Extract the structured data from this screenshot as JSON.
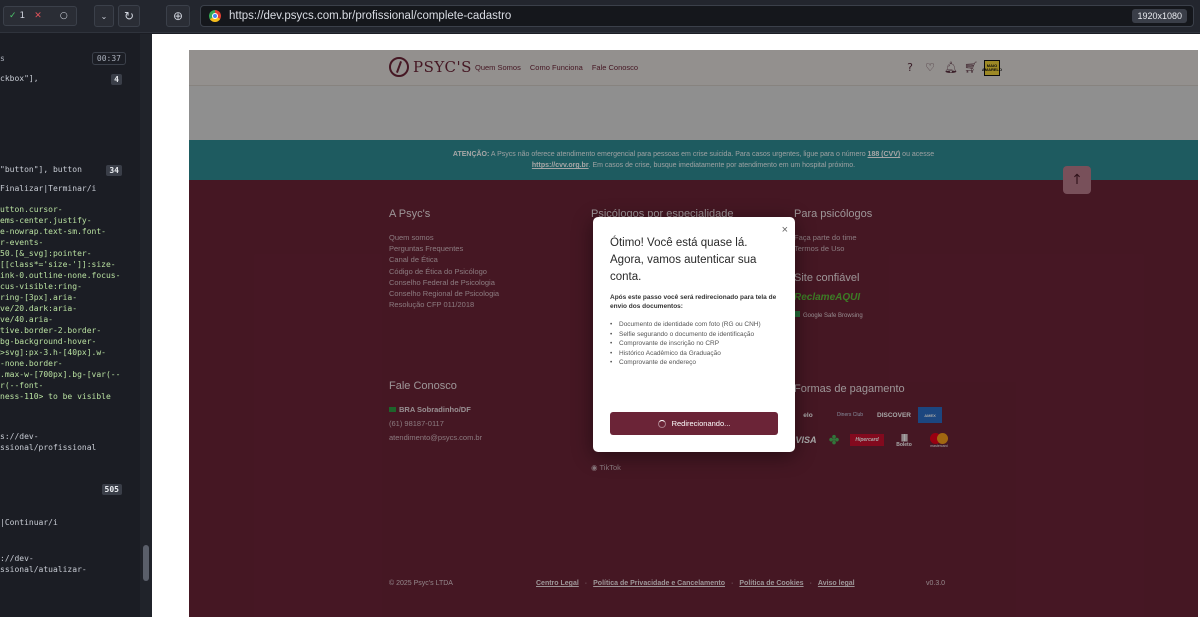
{
  "toolbar": {
    "pass_count": "1",
    "fail_count": "",
    "pending_count": "",
    "url": "https://dev.psycs.com.br/profissional/complete-cadastro",
    "resolution": "1920x1080"
  },
  "left_panel": {
    "header": "s",
    "time": "00:37",
    "lines": [
      {
        "text": "ckbox\"],",
        "badge": "4"
      },
      {
        "text": "\"button\"], button",
        "badge": "34"
      },
      {
        "text": "Finalizar|Terminar/i"
      },
      {
        "text": "utton.cursor-"
      },
      {
        "text": "ems-center.justify-"
      },
      {
        "text": "e-nowrap.text-sm.font-"
      },
      {
        "text": "r-events-"
      },
      {
        "text": "50.[&_svg]:pointer-"
      },
      {
        "text": "[[class*='size-']]:size-"
      },
      {
        "text": "ink-0.outline-none.focus-"
      },
      {
        "text": "cus-visible:ring-"
      },
      {
        "text": "ring-[3px].aria-"
      },
      {
        "text": "ve/20.dark:aria-"
      },
      {
        "text": "ve/40.aria-"
      },
      {
        "text": "tive.border-2.border-"
      },
      {
        "text": "bg-background-hover-"
      },
      {
        "text": ">svg]:px-3.h-[40px].w-"
      },
      {
        "text": "-none.border-"
      },
      {
        "text": ".max-w-[700px].bg-[var(--"
      },
      {
        "text": "r(--font-"
      },
      {
        "text": "ness-110>  to be  visible"
      },
      {
        "text": "s://dev-"
      },
      {
        "text": "ssional/profissional"
      },
      {
        "text": "",
        "badge": "505"
      },
      {
        "text": "|Continuar/i"
      },
      {
        "text": "://dev-"
      },
      {
        "text": "ssional/atualizar-"
      }
    ]
  },
  "site": {
    "logo": "PSYC'S",
    "nav": [
      "Quem Somos",
      "Como Funciona",
      "Fale Conosco"
    ],
    "flag_text": "MAIO AMARELO",
    "attention": {
      "label": "ATENÇÃO:",
      "text1": " A Psycs não oferece atendimento emergencial para pessoas em crise suicida. Para casos urgentes, ligue para o número ",
      "phone": "188 (CVV)",
      "text2": " ou acesse",
      "link": "https://cvv.org.br",
      "text3": ". Em casos de crise, busque imediatamente por atendimento em um hospital próximo."
    },
    "col1": {
      "title": "A Psyc's",
      "links": [
        "Quem somos",
        "Perguntas Frequentes",
        "Canal de Ética",
        "Código de Ética do Psicólogo",
        "Conselho Federal de Psicologia",
        "Conselho Regional de Psicologia",
        "Resolução CFP 011/2018"
      ]
    },
    "col2": {
      "title": "Psicólogos por especialidade",
      "social": "TikTok"
    },
    "col3": {
      "title": "Para psicólogos",
      "links": [
        "Faça parte do time",
        "Termos de Uso"
      ],
      "trust_title": "Site confiável",
      "reclame": "ReclameAQUI",
      "safe": "Google Safe Browsing",
      "pay_title": "Formas de pagamento",
      "pay_row1": [
        "elo",
        "Diners Club",
        "DISCOVER",
        "AMEX"
      ],
      "pay_row2": [
        "VISA",
        "",
        "Hipercard",
        "Boleto",
        "mastercard"
      ]
    },
    "contact": {
      "title": "Fale Conosco",
      "location": "BRA Sobradinho/DF",
      "phone": "(61) 98187-0117",
      "email": "atendimento@psycs.com.br"
    },
    "footer": {
      "copyright": "© 2025 Psyc's LTDA",
      "legal": [
        "Centro Legal",
        "Política de Privacidade e Cancelamento",
        "Política de Cookies",
        "Aviso legal"
      ],
      "version": "v0.3.0"
    }
  },
  "modal": {
    "title": "Ótimo! Você está quase lá. Agora, vamos autenticar sua conta.",
    "description": "Após este passo você será redirecionado para tela de envio dos documentos:",
    "items": [
      "Documento de identidade com foto (RG ou CNH)",
      "Selfie segurando o documento de identificação",
      "Comprovante de inscrição no CRP",
      "Histórico Acadêmico da Graduação",
      "Comprovante de endereço"
    ],
    "button": "Redirecionando..."
  }
}
